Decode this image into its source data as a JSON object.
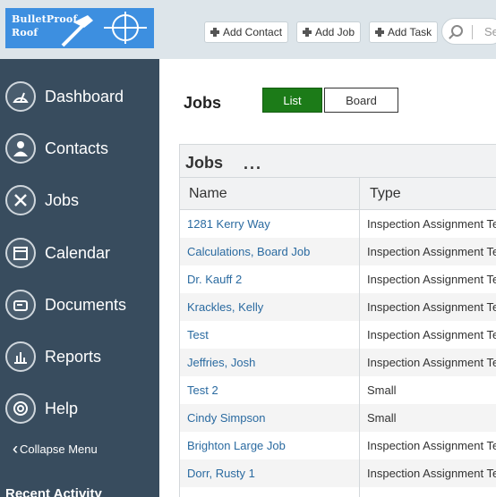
{
  "logo": {
    "line1": "BulletProof",
    "line2": "Roof"
  },
  "toolbar": {
    "add_contact": "Add Contact",
    "add_job": "Add Job",
    "add_task": "Add Task",
    "search_placeholder": "Se"
  },
  "sidebar": {
    "items": [
      {
        "label": "Dashboard",
        "icon": "dashboard-icon"
      },
      {
        "label": "Contacts",
        "icon": "contacts-icon"
      },
      {
        "label": "Jobs",
        "icon": "tools-icon"
      },
      {
        "label": "Calendar",
        "icon": "calendar-icon"
      },
      {
        "label": "Documents",
        "icon": "documents-icon"
      },
      {
        "label": "Reports",
        "icon": "reports-icon"
      },
      {
        "label": "Help",
        "icon": "help-icon"
      }
    ],
    "collapse_label": "Collapse Menu",
    "recent_activity": "Recent Activity"
  },
  "page": {
    "title": "Jobs",
    "view_list": "List",
    "view_board": "Board"
  },
  "panel": {
    "title": "Jobs",
    "more": "...",
    "columns": {
      "name": "Name",
      "type": "Type"
    },
    "rows": [
      {
        "name": "1281 Kerry Way",
        "type": "Inspection Assignment Te"
      },
      {
        "name": "Calculations, Board Job",
        "type": "Inspection Assignment Te"
      },
      {
        "name": "Dr. Kauff 2",
        "type": "Inspection Assignment Te"
      },
      {
        "name": "Krackles, Kelly",
        "type": "Inspection Assignment Te"
      },
      {
        "name": "Test",
        "type": "Inspection Assignment Te"
      },
      {
        "name": "Jeffries, Josh",
        "type": "Inspection Assignment Te"
      },
      {
        "name": "Test 2",
        "type": "Small"
      },
      {
        "name": "Cindy Simpson",
        "type": "Small"
      },
      {
        "name": "Brighton Large Job",
        "type": "Inspection Assignment Te"
      },
      {
        "name": "Dorr, Rusty 1",
        "type": "Inspection Assignment Te"
      }
    ]
  },
  "colors": {
    "sidebar_bg": "#384c5e",
    "topbar_bg": "#dde5ea",
    "accent_green": "#1c7b18",
    "link_blue": "#2a6aa0",
    "logo_blue": "#3d8fe0"
  }
}
